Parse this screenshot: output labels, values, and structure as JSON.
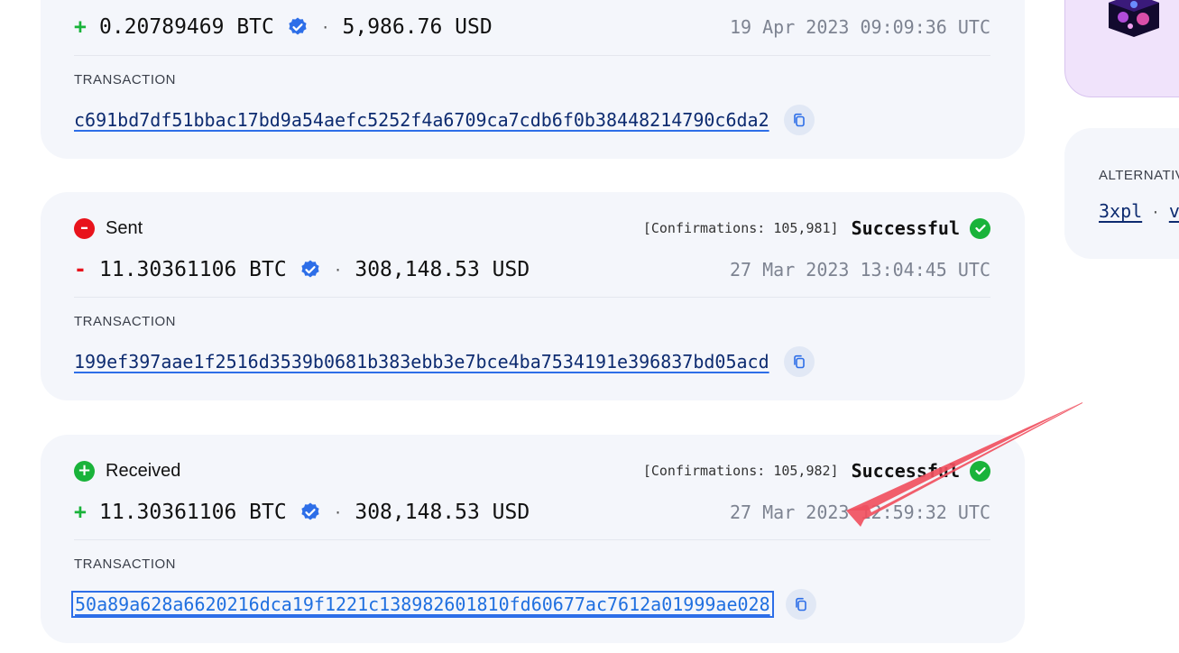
{
  "transactions": [
    {
      "sign": "+",
      "amount": "0.20789469 BTC",
      "separator": "·",
      "usd": "5,986.76 USD",
      "date": "19 Apr 2023 09:09:36 UTC",
      "tx_label": "TRANSACTION",
      "hash": "c691bd7df51bbac17bd9a54aefc5252f4a6709ca7cdb6f0b38448214790c6da2"
    },
    {
      "direction": "Sent",
      "confirmations": "[Confirmations: 105,981]",
      "status": "Successful",
      "sign": "-",
      "amount": "11.30361106 BTC",
      "separator": "·",
      "usd": "308,148.53 USD",
      "date": "27 Mar 2023 13:04:45 UTC",
      "tx_label": "TRANSACTION",
      "hash": "199ef397aae1f2516d3539b0681b383ebb3e7bce4ba7534191e396837bd05acd"
    },
    {
      "direction": "Received",
      "confirmations": "[Confirmations: 105,982]",
      "status": "Successful",
      "sign": "+",
      "amount": "11.30361106 BTC",
      "separator": "·",
      "usd": "308,148.53 USD",
      "date": "27 Mar 2023 12:59:32 UTC",
      "tx_label": "TRANSACTION",
      "hash": "50a89a628a6620216dca19f1221c138982601810fd60677ac7612a01999ae028"
    }
  ],
  "sidebar": {
    "alt_title": "ALTERNATIVE",
    "alt_links": [
      "3xpl",
      "v"
    ],
    "alt_separator": "·"
  },
  "icons": {
    "verified": "verified-badge-icon",
    "copy": "copy-icon",
    "success": "check-circle-icon",
    "sent": "minus-circle-icon",
    "received": "plus-circle-icon",
    "annotation": "red-arrow-annotation"
  },
  "colors": {
    "card_bg": "#f4f6fb",
    "positive": "#19b33a",
    "negative": "#e8131c",
    "link": "#2d6ee8",
    "date": "#7d8391",
    "promo_bg": "#f0e3fb",
    "arrow": "#f0505f"
  }
}
